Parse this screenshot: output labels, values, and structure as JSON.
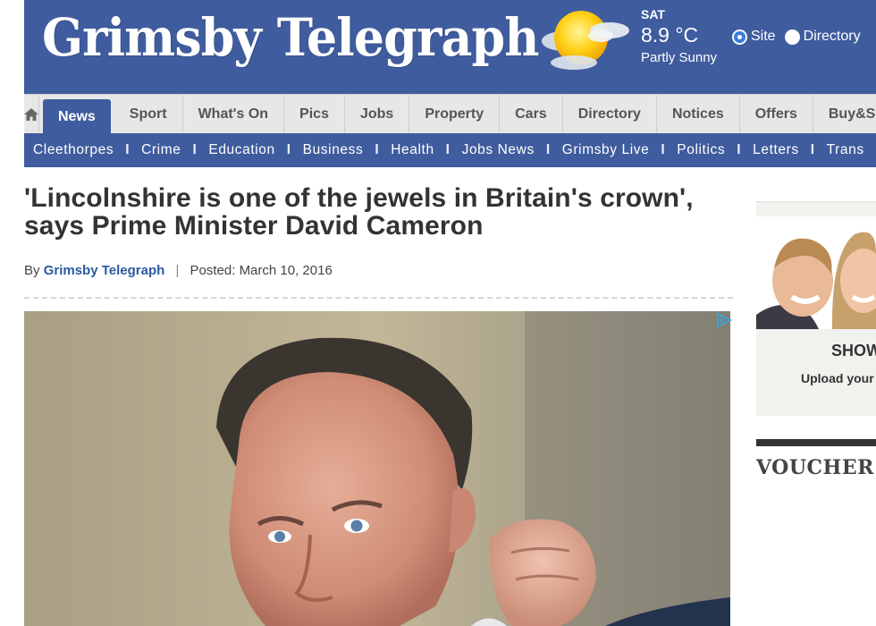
{
  "header": {
    "logo_text": "Grimsby Telegraph",
    "weather": {
      "icon": "partly-sunny-icon",
      "day": "SAT",
      "temperature": "8.9 °C",
      "condition": "Partly Sunny"
    },
    "search_scope": {
      "options": [
        "Site",
        "Directory"
      ],
      "selected": "Site"
    }
  },
  "main_nav": {
    "home_icon": "home-icon",
    "items": [
      "News",
      "Sport",
      "What's On",
      "Pics",
      "Jobs",
      "Property",
      "Cars",
      "Directory",
      "Notices",
      "Offers",
      "Buy&Se"
    ],
    "active": "News"
  },
  "sub_nav": {
    "separator": "I",
    "items": [
      "Cleethorpes",
      "Crime",
      "Education",
      "Business",
      "Health",
      "Jobs News",
      "Grimsby Live",
      "Politics",
      "Letters",
      "Trans"
    ]
  },
  "article": {
    "headline_line1": "'Lincolnshire is one of the jewels in Britain's crown',",
    "headline_line2": "says Prime Minister David Cameron",
    "byline_prefix": "By",
    "author": "Grimsby Telegraph",
    "separator": "|",
    "posted": "Posted: March 10, 2016",
    "ad_choices_icon": "adchoices-icon"
  },
  "sidebar": {
    "promo_heading": "SHOW",
    "promo_text": "Upload your",
    "voucher_heading": "VOUCHER"
  },
  "colors": {
    "brand_blue": "#3f5c9e",
    "nav_grey": "#e7e7e7",
    "author_link": "#2c5aa0"
  }
}
